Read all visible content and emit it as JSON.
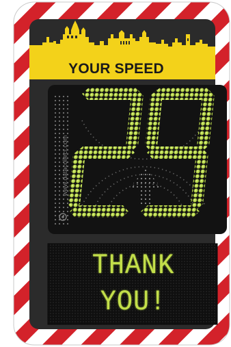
{
  "sign": {
    "heading": "YOUR SPEED",
    "speed": "29",
    "website": "www.datacollect.com",
    "message_line1": "THANK",
    "message_line2": "YOU!"
  },
  "colors": {
    "border_red": "#d3222a",
    "border_white": "#ffffff",
    "panel": "#2b2b2b",
    "banner_yellow": "#f3d21a",
    "led_green": "#c3df4a",
    "display_bg": "#111111"
  },
  "icons": [
    "city-skyline-icon",
    "arrow-up-icon",
    "datacollect-logo-icon"
  ]
}
